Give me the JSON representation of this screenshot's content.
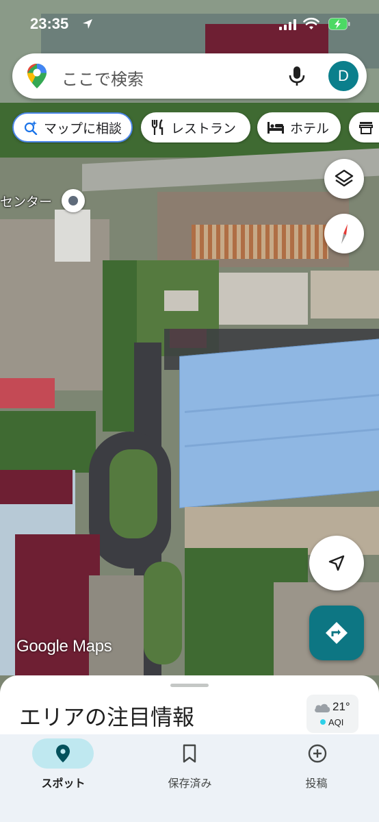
{
  "status_bar": {
    "time": "23:35"
  },
  "search": {
    "placeholder": "ここで検索",
    "avatar_letter": "D"
  },
  "chips": [
    {
      "label": "マップに相談",
      "icon": "sparkle-search-icon"
    },
    {
      "label": "レストラン",
      "icon": "fork-knife-icon"
    },
    {
      "label": "ホテル",
      "icon": "bed-icon"
    }
  ],
  "map": {
    "place_label": "センター",
    "logo": "Google Maps"
  },
  "sheet": {
    "title": "エリアの注目情報",
    "weather": {
      "temp": "21°",
      "aqi": "AQI"
    }
  },
  "nav": [
    {
      "label": "スポット",
      "icon": "pin-icon",
      "active": true
    },
    {
      "label": "保存済み",
      "icon": "bookmark-icon",
      "active": false
    },
    {
      "label": "投稿",
      "icon": "add-circle-icon",
      "active": false
    }
  ],
  "colors": {
    "accent": "#0d7683",
    "avatar": "#0b7f8c",
    "active_pill": "#bfe8f0"
  }
}
